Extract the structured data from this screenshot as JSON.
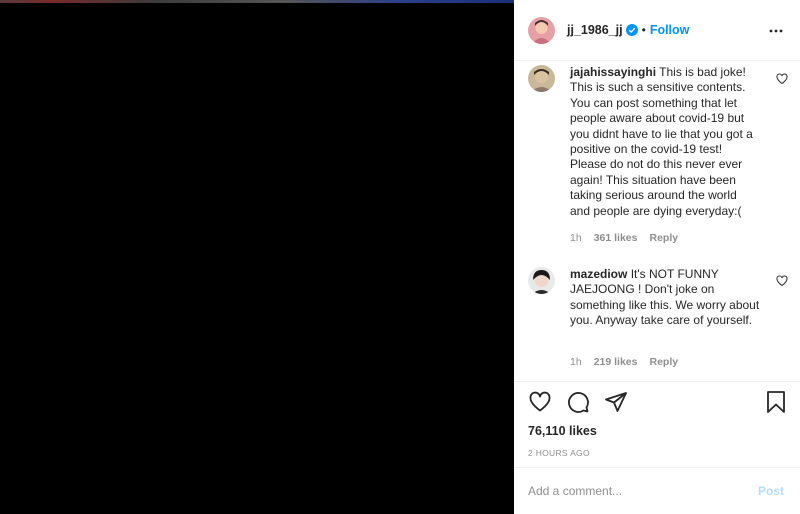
{
  "post": {
    "username": "jj_1986_jj",
    "separator": "•",
    "follow_label": "Follow",
    "likes": "76,110 likes",
    "time_ago": "2 HOURS AGO"
  },
  "comments": [
    {
      "username": "jajahissayinghi",
      "text": "This is bad joke! This is such a sensitive contents. You can post something that let people aware about covid-19 but you didnt have to lie that you got a positive on the covid-19 test! Please do not do this never ever again! This situation have been taking serious around the world and people are dying everyday:(",
      "time": "1h",
      "likes": "361 likes",
      "reply_label": "Reply"
    },
    {
      "username": "mazediow",
      "text": "It's NOT FUNNY JAEJOONG ! Don't joke on something like this. We worry about you. Anyway take care of yourself.",
      "time": "1h",
      "likes": "219 likes",
      "reply_label": "Reply"
    }
  ],
  "add_comment": {
    "placeholder": "Add a comment...",
    "post_label": "Post"
  },
  "colors": {
    "accent": "#0095f6",
    "post_disabled": "#b2dffc",
    "text": "#262626",
    "muted": "#8e8e8e",
    "media_bg": "#000000"
  },
  "icons": {
    "verified": "verified-badge-icon",
    "more": "more-options-icon",
    "like": "heart-icon",
    "comment": "comment-bubble-icon",
    "share": "paper-plane-icon",
    "save": "bookmark-icon"
  }
}
